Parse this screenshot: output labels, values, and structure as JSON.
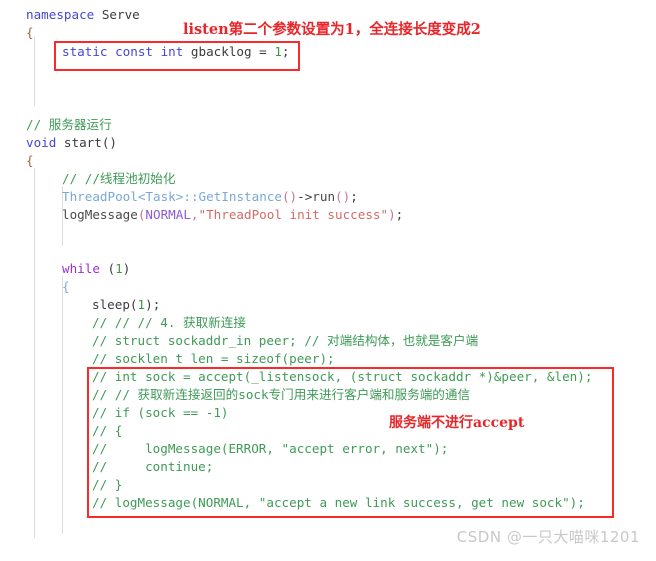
{
  "editor": {
    "language": "cpp",
    "background": "#ffffff",
    "colors": {
      "keyword": "#4646d6",
      "control_keyword": "#9b30c8",
      "type": "#7aa8d6",
      "comment": "#3f9a57",
      "string": "#d46a6a",
      "number": "#3a9a3a",
      "constant": "#8a5ad6",
      "punctuation": "#c2749a",
      "plain_text": "#3b3b3b",
      "annotation_red": "#e8262a",
      "box_red": "#fa2a2a",
      "indent_guide": "#dcdcdc",
      "watermark": "#c8c8c8"
    }
  },
  "lines": {
    "l01_namespace_kw": "namespace",
    "l01_namespace_name": " Serve",
    "l02_brace_open": "{",
    "l03_static": "static const int",
    "l03_name": " gbacklog = ",
    "l03_num": "1",
    "l03_semi": ";",
    "l06_comment": "// 服务器运行",
    "l07_void": "void",
    "l07_fn": " start()",
    "l08_brace": "{",
    "l09_comment": "// //线程池初始化",
    "l10_type": "ThreadPool",
    "l10_lt": "<",
    "l10_task": "Task",
    "l10_gt": ">",
    "l10_colons": "::",
    "l10_getinstance": "GetInstance",
    "l10_call": "()",
    "l10_arrow": "->",
    "l10_run": "run",
    "l10_runcall": "()",
    "l10_semi": ";",
    "l11_fn": "logMessage",
    "l11_open": "(",
    "l11_const": "NORMAL",
    "l11_comma": ",",
    "l11_str": "\"ThreadPool init success\"",
    "l11_close": ")",
    "l11_semi": ";",
    "l13_while": "while",
    "l13_cond": " (",
    "l13_num": "1",
    "l13_cond_close": ")",
    "l14_brace": "{",
    "l15_sleep": "sleep",
    "l15_open": "(",
    "l15_num": "1",
    "l15_close": ")",
    "l15_semi": ";",
    "l16_comment": "// // // 4. 获取新连接",
    "l17_comment": "// struct sockaddr_in peer; // 对端结构体，也就是客户端",
    "l18_comment": "// socklen t len = sizeof(peer);",
    "l19_comment": "// int sock = accept(_listensock, (struct sockaddr *)&peer, &len);",
    "l20_comment": "// // 获取新连接返回的sock专门用来进行客户端和服务端的通信",
    "l21_comment": "// if (sock == -1)",
    "l22_comment": "// {",
    "l23_comment": "//     logMessage(ERROR, \"accept error, next\");",
    "l24_comment": "//     continue;",
    "l25_comment": "// }",
    "l26_comment": "// logMessage(NORMAL, \"accept a new link success, get new sock\");"
  },
  "annotations": [
    {
      "id": "listen-note",
      "text": "listen第二个参数设置为1，全连接长度变成2"
    },
    {
      "id": "accept-note",
      "text": "服务端不进行accept"
    }
  ],
  "highlight_boxes": [
    {
      "id": "gbacklog-box",
      "label": "static-const-gbacklog-highlight"
    },
    {
      "id": "accept-block-box",
      "label": "commented-accept-block-highlight"
    }
  ],
  "watermark": {
    "text": "CSDN @一只大喵咪1201"
  }
}
